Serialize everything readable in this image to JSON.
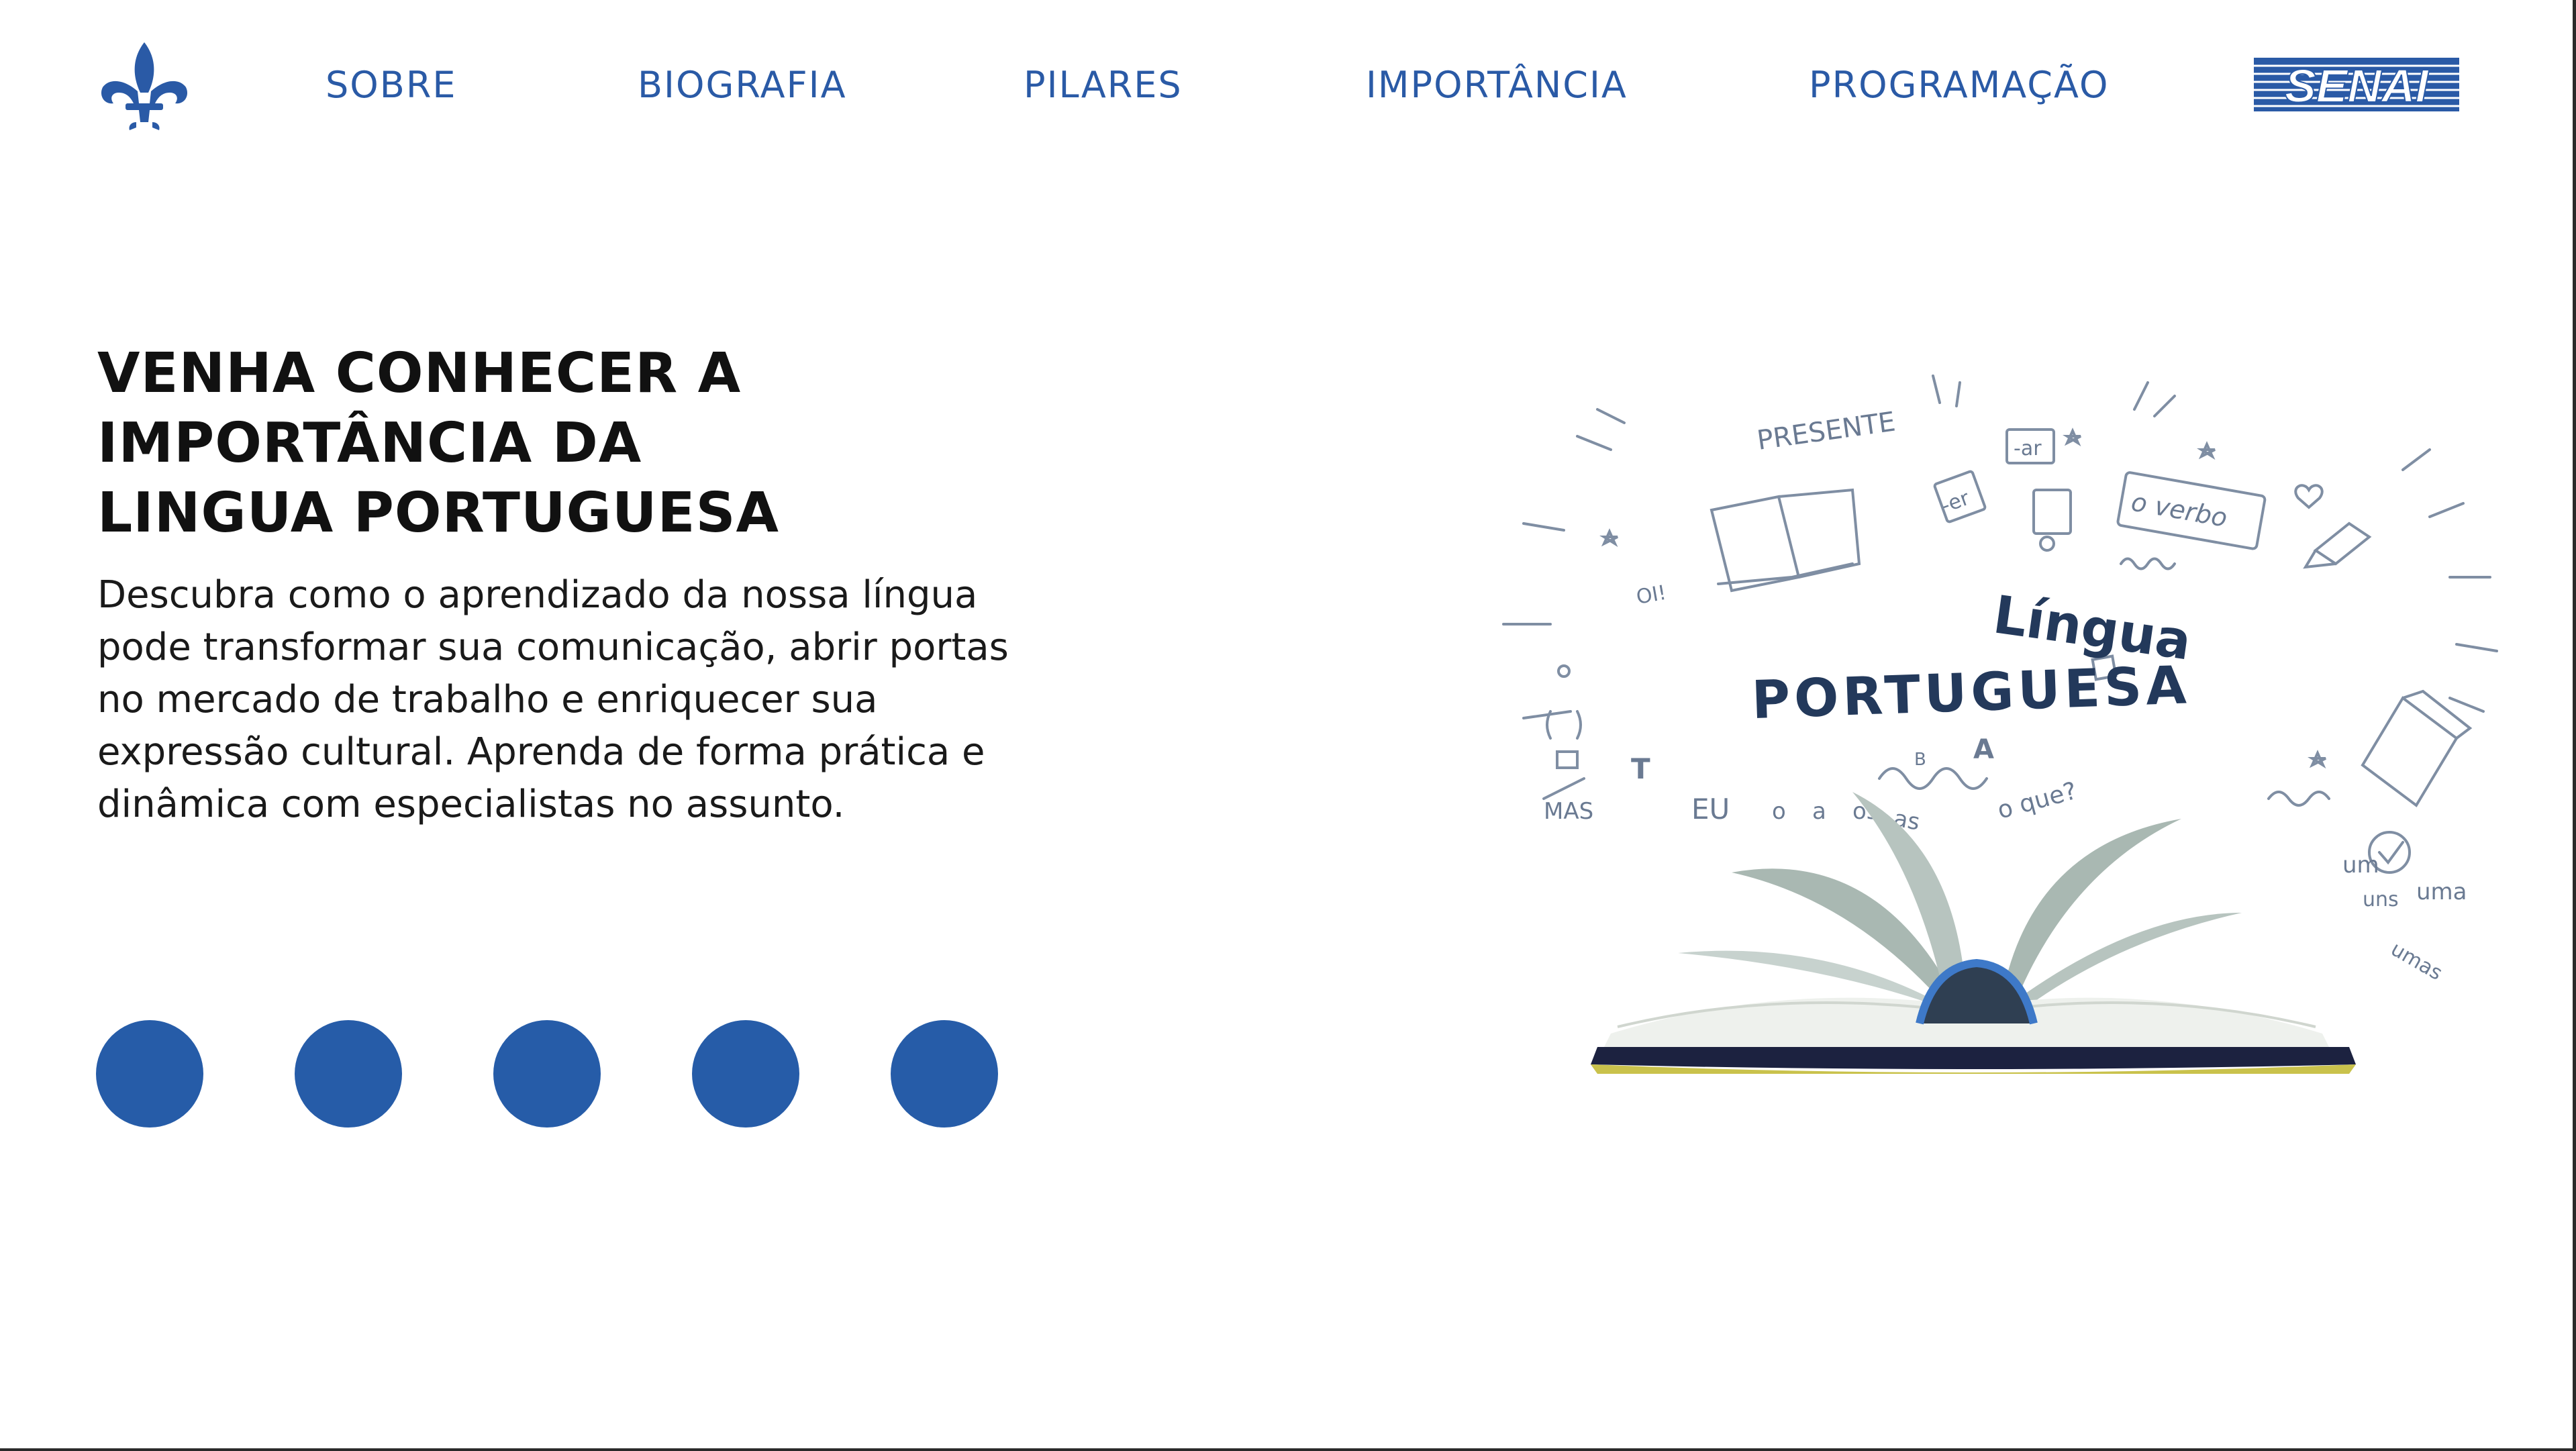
{
  "header": {
    "nav": [
      "SOBRE",
      "BIOGRAFIA",
      "PILARES",
      "IMPORTÂNCIA",
      "PROGRAMAÇÃO"
    ],
    "logo_icon": "fleur-de-lis-icon",
    "brand": "SENAI"
  },
  "hero": {
    "title_lines": [
      "VENHA CONHECER A",
      "IMPORTÂNCIA DA",
      "LINGUA PORTUGUESA"
    ],
    "description": "Descubra como o aprendizado da nossa língua pode transformar sua comunicação, abrir portas no mercado de trabalho e enriquecer sua expressão cultural. Aprenda de forma prática e dinâmica com especialistas no assunto."
  },
  "carousel": {
    "dots": 5,
    "color": "#265ca8"
  },
  "illustration": {
    "title_top": "Língua",
    "title_bottom": "PORTUGUESA",
    "words": [
      "PRESENTE",
      "-ar",
      "-er",
      "o verbo",
      "OI!",
      "MAS",
      "EU",
      "o",
      "a",
      "os",
      "as",
      "o que?",
      "um",
      "uma",
      "uns",
      "umas",
      "B",
      "A",
      "T"
    ]
  },
  "colors": {
    "nav": "#2a5aa6",
    "accent": "#265ca8",
    "text": "#111111"
  }
}
